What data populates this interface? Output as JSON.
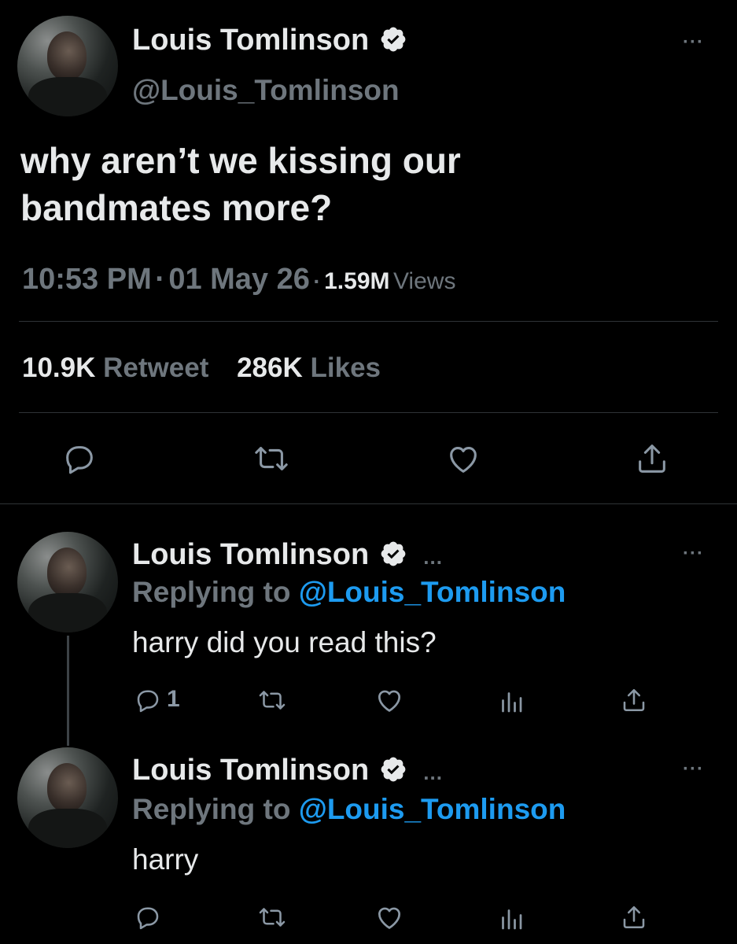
{
  "main_tweet": {
    "author_name": "Louis Tomlinson",
    "author_handle": "@Louis_Tomlinson",
    "text_line1": "why aren’t we kissing our",
    "text_line2": "bandmates more?",
    "time": "10:53 PM",
    "separator": "·",
    "date": "01 May 26",
    "views_count": "1.59M",
    "views_label": "Views",
    "retweet_count": "10.9K",
    "retweet_label": "Retweet",
    "likes_count": "286K",
    "likes_label": "Likes",
    "more_menu": "···"
  },
  "replies": [
    {
      "author_name": "Louis Tomlinson",
      "ellipsis": "...",
      "replying_prefix": "Replying to",
      "replying_handle": "@Louis_Tomlinson",
      "text": "harry did you read this?",
      "reply_count": "1",
      "more_menu": "···"
    },
    {
      "author_name": "Louis Tomlinson",
      "ellipsis": "...",
      "replying_prefix": "Replying to",
      "replying_handle": "@Louis_Tomlinson",
      "text": "harry",
      "reply_count": "",
      "more_menu": "···"
    }
  ],
  "icons": [
    "verified-badge-icon",
    "reply-icon",
    "retweet-icon",
    "like-icon",
    "share-icon",
    "views-icon",
    "more-icon"
  ],
  "colors": {
    "background": "#000000",
    "text": "#e7e9ea",
    "muted": "#6e767d",
    "link": "#1d9bf0",
    "divider": "#2f3336"
  }
}
